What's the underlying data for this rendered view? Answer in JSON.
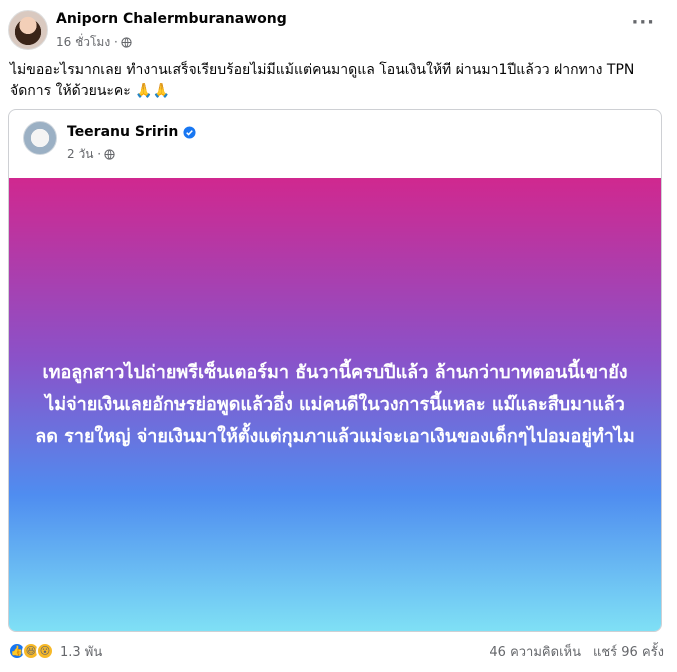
{
  "post": {
    "author": "Aniporn Chalermburanawong",
    "time": "16 ชั่วโมง ·",
    "more_icon": "more-horizontal-icon",
    "text": "ไม่ขออะไรมากเลย ทำงานเสร็จเรียบร้อยไม่มีแม้แต่คนมาดูแล โอนเงินให้ที ผ่านมา1ปีแล้วว ฝากทาง TPN จัดการ ให้ด้วยนะคะ 🙏🙏"
  },
  "shared_post": {
    "author": "Teeranu Sririn",
    "time": "2 วัน ·",
    "banner_text": "เทอลูกสาวไปถ่ายพรีเซ็นเตอร์มา ธันวานี้ครบปีแล้ว ล้านกว่าบาทตอนนี้เขายังไม่จ่ายเงินเลยอักษรย่อพูดแล้วอึ่ง แม่คนดีในวงการนี้แหละ แม๊และสืบมาแล้ว ลด รายใหญ่ จ่ายเงินมาให้ตั้งแต่กุมภาแล้วแม่จะเอาเงินของเด็กๆไปอมอยู่ทำไม"
  },
  "footer": {
    "reaction_count": "1.3 พัน",
    "comments": "46 ความคิดเห็น",
    "shares": "แชร์ 96 ครั้ง"
  },
  "colors": {
    "link_blue": "#1877f2",
    "meta_gray": "#65676b",
    "gradient_top": "#d0288f",
    "gradient_bottom": "#7fe0f5"
  }
}
